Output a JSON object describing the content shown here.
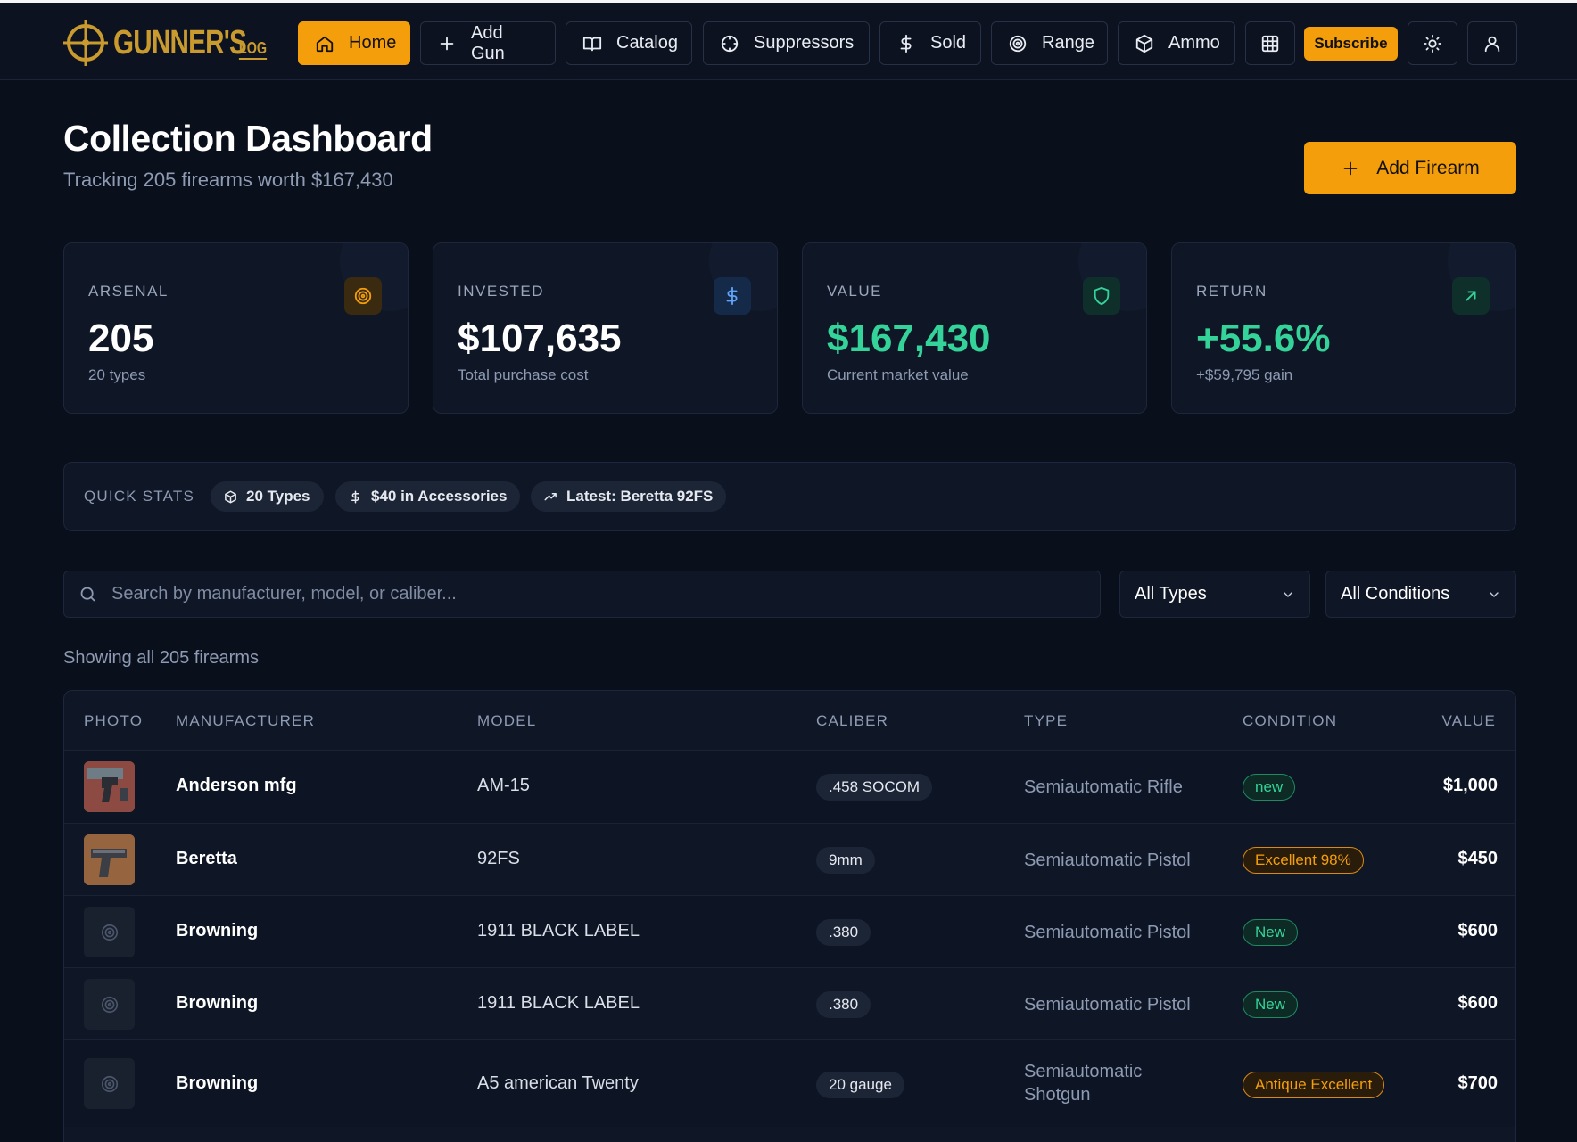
{
  "nav": {
    "logo_text": "GUNNER'S",
    "logo_sub": "LOG",
    "items": [
      {
        "label": "Home",
        "icon": "home-icon"
      },
      {
        "label": "Add Gun",
        "icon": "plus-icon"
      },
      {
        "label": "Catalog",
        "icon": "book-icon"
      },
      {
        "label": "Suppressors",
        "icon": "crosshair-icon"
      },
      {
        "label": "Sold",
        "icon": "dollar-icon"
      },
      {
        "label": "Range",
        "icon": "target-icon"
      },
      {
        "label": "Ammo",
        "icon": "box-icon"
      }
    ],
    "grid_icon": "grid-icon",
    "subscribe_label": "Subscribe",
    "theme_icon": "sun-icon",
    "user_icon": "user-icon"
  },
  "header": {
    "title": "Collection Dashboard",
    "subtitle": "Tracking 205 firearms worth $167,430",
    "add_label": "Add Firearm"
  },
  "stats": [
    {
      "label": "ARSENAL",
      "value": "205",
      "caption": "20 types",
      "icon": "target-icon",
      "accent": "#f59e0b"
    },
    {
      "label": "INVESTED",
      "value": "$107,635",
      "caption": "Total purchase cost",
      "icon": "dollar-icon",
      "accent": "#60a5fa"
    },
    {
      "label": "VALUE",
      "value": "$167,430",
      "caption": "Current market value",
      "icon": "shield-icon",
      "accent": "#34d399"
    },
    {
      "label": "RETURN",
      "value": "+55.6%",
      "caption": "+$59,795 gain",
      "icon": "trend-up-icon",
      "accent": "#34d399"
    }
  ],
  "quick_stats": {
    "label": "QUICK STATS",
    "chips": [
      {
        "label": "20 Types",
        "icon": "box-icon"
      },
      {
        "label": "$40 in Accessories",
        "icon": "dollar-icon"
      },
      {
        "label": "Latest: Beretta 92FS",
        "icon": "trending-icon"
      }
    ]
  },
  "filters": {
    "search_placeholder": "Search by manufacturer, model, or caliber...",
    "type_selected": "All Types",
    "condition_selected": "All Conditions"
  },
  "showing": "Showing all 205 firearms",
  "table": {
    "headers": [
      "PHOTO",
      "MANUFACTURER",
      "MODEL",
      "CALIBER",
      "TYPE",
      "CONDITION",
      "VALUE"
    ],
    "rows": [
      {
        "photo": "photo-rifle",
        "manufacturer": "Anderson mfg",
        "model": "AM-15",
        "caliber": ".458 SOCOM",
        "type": "Semiautomatic Rifle",
        "condition": "new",
        "cond_color": "green",
        "value": "$1,000"
      },
      {
        "photo": "photo-pistol",
        "manufacturer": "Beretta",
        "model": "92FS",
        "caliber": "9mm",
        "type": "Semiautomatic Pistol",
        "condition": "Excellent 98%",
        "cond_color": "orange",
        "value": "$450"
      },
      {
        "photo": "placeholder",
        "manufacturer": "Browning",
        "model": "1911 BLACK LABEL",
        "caliber": ".380",
        "type": "Semiautomatic Pistol",
        "condition": "New",
        "cond_color": "green",
        "value": "$600"
      },
      {
        "photo": "placeholder",
        "manufacturer": "Browning",
        "model": "1911 BLACK LABEL",
        "caliber": ".380",
        "type": "Semiautomatic Pistol",
        "condition": "New",
        "cond_color": "green",
        "value": "$600"
      },
      {
        "photo": "placeholder",
        "manufacturer": "Browning",
        "model": "A5 american Twenty",
        "caliber": "20 gauge",
        "type_line1": "Semiautomatic",
        "type_line2": "Shotgun",
        "condition": "Antique Excellent",
        "cond_color": "orange",
        "value": "$700"
      }
    ]
  }
}
